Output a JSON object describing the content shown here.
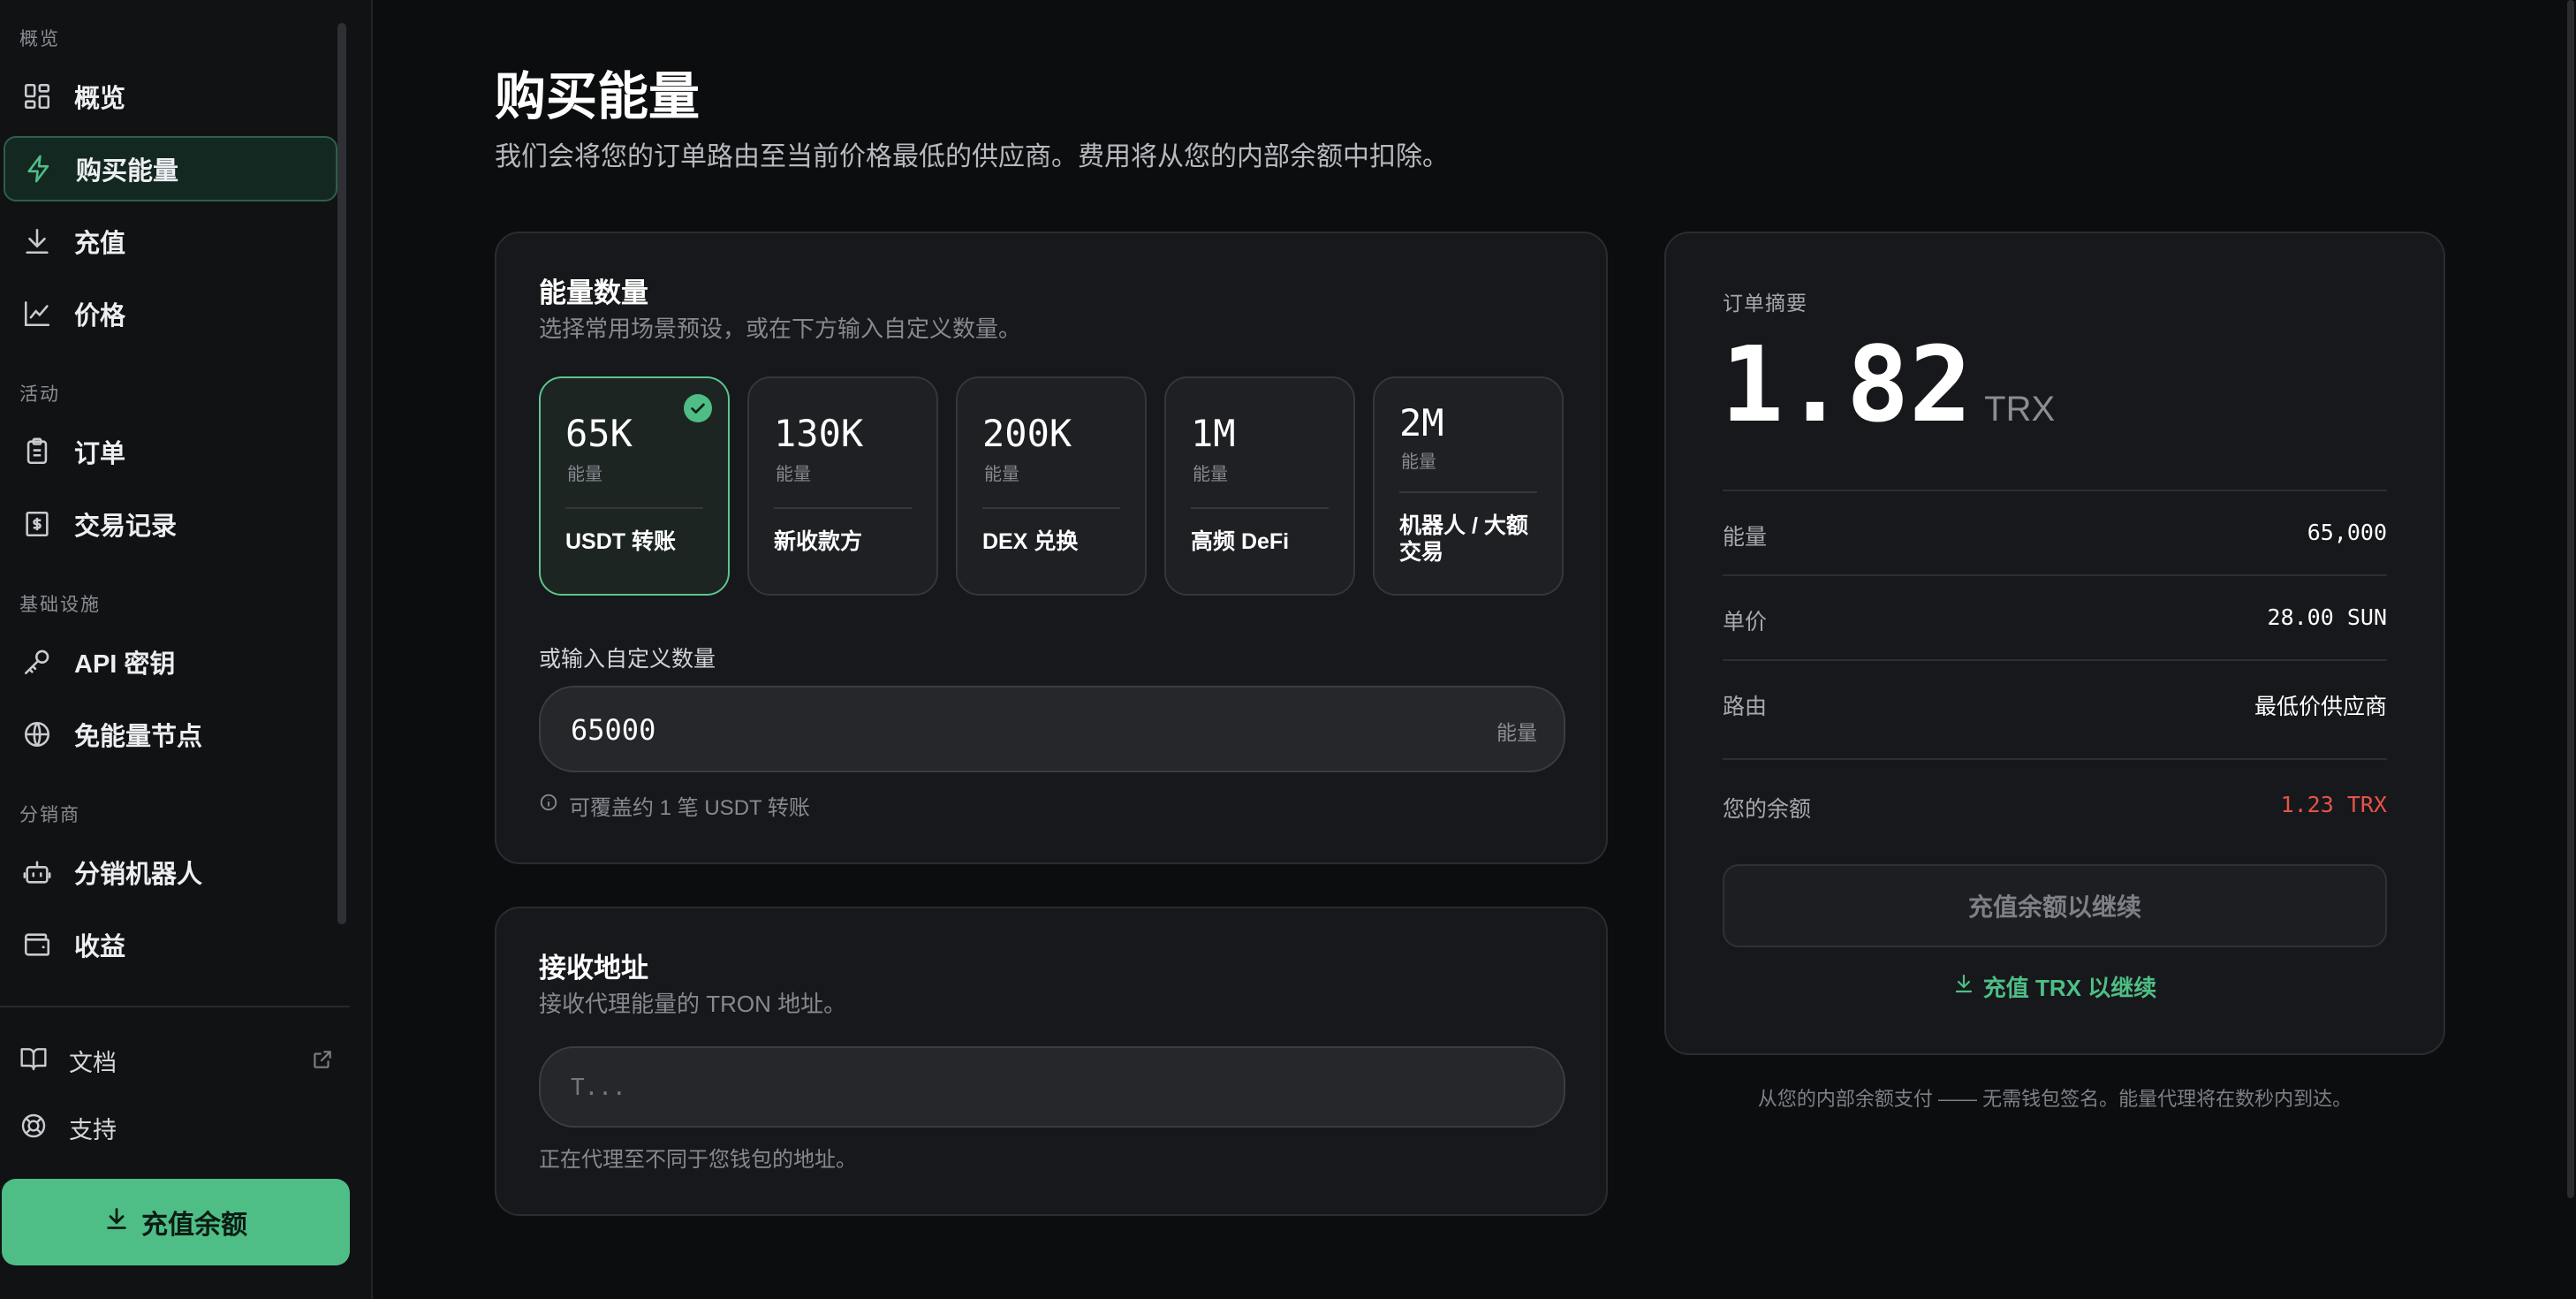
{
  "sidebar": {
    "sections": [
      "概览",
      "活动",
      "基础设施",
      "分销商"
    ],
    "items": [
      {
        "label": "概览",
        "icon": "dashboard-grid-icon"
      },
      {
        "label": "购买能量",
        "icon": "lightning-icon",
        "active": true
      },
      {
        "label": "充值",
        "icon": "download-icon"
      },
      {
        "label": "价格",
        "icon": "line-chart-icon"
      },
      {
        "label": "订单",
        "icon": "clipboard-icon"
      },
      {
        "label": "交易记录",
        "icon": "receipt-icon"
      },
      {
        "label": "API 密钥",
        "icon": "key-icon"
      },
      {
        "label": "免能量节点",
        "icon": "globe-icon"
      },
      {
        "label": "分销机器人",
        "icon": "bot-icon"
      },
      {
        "label": "收益",
        "icon": "wallet-icon"
      }
    ],
    "footer": [
      {
        "label": "文档",
        "icon": "book-icon"
      },
      {
        "label": "支持",
        "icon": "lifebuoy-icon"
      }
    ],
    "topup_button": "充值余额"
  },
  "page": {
    "title": "购买能量",
    "subtitle": "我们会将您的订单路由至当前价格最低的供应商。费用将从您的内部余额中扣除。"
  },
  "energy_card": {
    "title": "能量数量",
    "subtitle": "选择常用场景预设，或在下方输入自定义数量。",
    "presets": [
      {
        "amount": "65K",
        "unit": "能量",
        "label": "USDT 转账",
        "selected": true
      },
      {
        "amount": "130K",
        "unit": "能量",
        "label": "新收款方"
      },
      {
        "amount": "200K",
        "unit": "能量",
        "label": "DEX 兑换"
      },
      {
        "amount": "1M",
        "unit": "能量",
        "label": "高频 DeFi"
      },
      {
        "amount": "2M",
        "unit": "能量",
        "label": "机器人 / 大额交易"
      }
    ],
    "custom_label": "或输入自定义数量",
    "custom_value": "65000",
    "custom_unit": "能量",
    "hint": "可覆盖约 1 笔 USDT 转账"
  },
  "address_card": {
    "title": "接收地址",
    "subtitle": "接收代理能量的 TRON 地址。",
    "placeholder": "T...",
    "note": "正在代理至不同于您钱包的地址。"
  },
  "summary": {
    "heading": "订单摘要",
    "total": "1.82",
    "currency": "TRX",
    "rows": [
      {
        "key": "能量",
        "value": "65,000"
      },
      {
        "key": "单价",
        "value": "28.00 SUN"
      },
      {
        "key": "路由",
        "value": "最低价供应商"
      }
    ],
    "balance_label": "您的余额",
    "balance_value": "1.23 TRX",
    "balance_color": "#e5534b",
    "disabled_button": "充值余额以继续",
    "topup_link": "充值 TRX 以继续",
    "footnote": "从您的内部余额支付 —— 无需钱包签名。能量代理将在数秒内到达。"
  },
  "colors": {
    "accent": "#4fbe86",
    "background": "#0c0d0f",
    "card": "#17181b"
  }
}
